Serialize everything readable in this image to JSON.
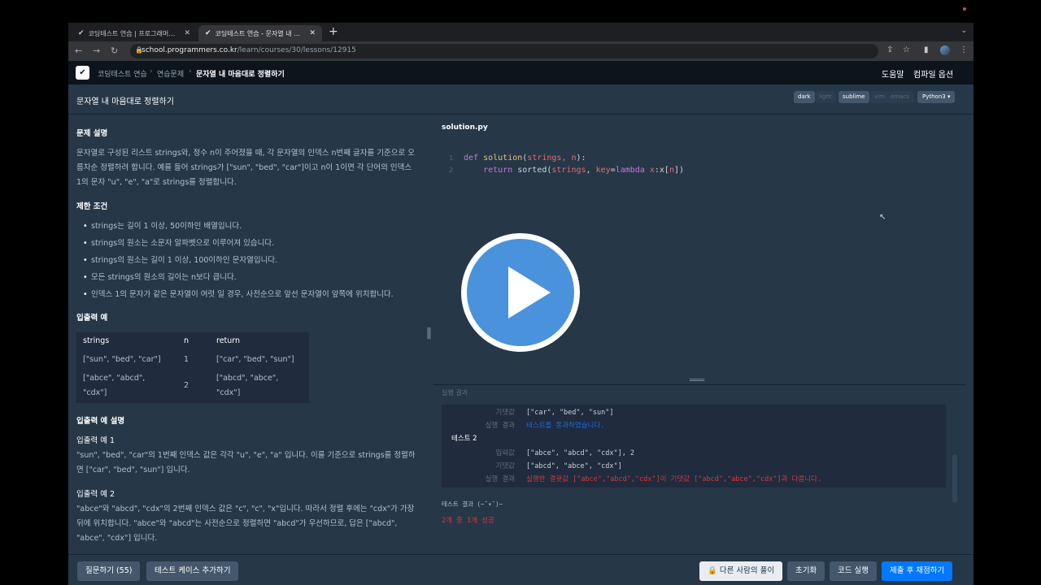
{
  "browser": {
    "tabs": [
      {
        "title": "코딩테스트 연습 | 프로그래머스 스쿨",
        "active": false
      },
      {
        "title": "코딩테스트 연습 - 문자열 내 마음대로 정렬하기",
        "active": true
      }
    ],
    "url_host": "school.programmers.co.kr",
    "url_path": "/learn/courses/30/lessons/12915"
  },
  "header": {
    "breadcrumb": [
      "코딩테스트 연습",
      "연습문제",
      "문자열 내 마음대로 정렬하기"
    ],
    "help": "도움말",
    "compile_options": "컴파일 옵션"
  },
  "titlebar": {
    "title": "문자열 내 마음대로 정렬하기",
    "themes": [
      "dark",
      "light"
    ],
    "keymaps": [
      "sublime",
      "vim",
      "emacs"
    ],
    "language": "Python3 ▾"
  },
  "problem": {
    "desc_title": "문제 설명",
    "desc": "문자열로 구성된 리스트 strings와, 정수 n이 주어졌을 때, 각 문자열의 인덱스 n번째 글자를 기준으로 오름차순 정렬하려 합니다. 예를 들어 strings가 [\"sun\", \"bed\", \"car\"]이고 n이 1이면 각 단어의 인덱스 1의 문자 \"u\", \"e\", \"a\"로 strings를 정렬합니다.",
    "constraints_title": "제한 조건",
    "constraints": [
      "strings는 길이 1 이상, 50이하인 배열입니다.",
      "strings의 원소는 소문자 알파벳으로 이루어져 있습니다.",
      "strings의 원소는 길이 1 이상, 100이하인 문자열입니다.",
      "모든 strings의 원소의 길이는 n보다 큽니다.",
      "인덱스 1의 문자가 같은 문자열이 여럿 일 경우, 사전순으로 앞선 문자열이 앞쪽에 위치합니다."
    ],
    "io_title": "입출력 예",
    "io_headers": [
      "strings",
      "n",
      "return"
    ],
    "io_rows": [
      [
        "[\"sun\", \"bed\", \"car\"]",
        "1",
        "[\"car\", \"bed\", \"sun\"]"
      ],
      [
        "[\"abce\", \"abcd\", \"cdx\"]",
        "2",
        "[\"abcd\", \"abce\", \"cdx\"]"
      ]
    ],
    "io_explain_title": "입출력 예 설명",
    "ex1_title": "입출력 예 1",
    "ex1": "\"sun\", \"bed\", \"car\"의 1번째 인덱스 값은 각각 \"u\", \"e\", \"a\" 입니다. 이를 기준으로 strings를 정렬하면 [\"car\", \"bed\", \"sun\"] 입니다.",
    "ex2_title": "입출력 예 2",
    "ex2": "\"abce\"와 \"abcd\", \"cdx\"의 2번째 인덱스 값은 \"c\", \"c\", \"x\"입니다. 따라서 정렬 후에는 \"cdx\"가 가장 뒤에 위치합니다. \"abce\"와 \"abcd\"는 사전순으로 정렬하면 \"abcd\"가 우선하므로, 답은 [\"abcd\", \"abce\", \"cdx\"] 입니다."
  },
  "editor": {
    "filename": "solution.py",
    "line_numbers": [
      "1",
      "2"
    ],
    "line1_kw": "def",
    "line1_fn": "solution",
    "line1_open": "(",
    "line1_params": "strings, n",
    "line1_close": "):",
    "line2_kw": "return",
    "line2_a": " sorted(",
    "line2_b": "strings",
    "line2_c": ", ",
    "line2_d": "key",
    "line2_e": "=",
    "line2_f": "lambda",
    "line2_g": " ",
    "line2_h": "x",
    "line2_i": ":x[",
    "line2_j": "n",
    "line2_k": "])"
  },
  "results": {
    "label": "실행 결과",
    "row1_key": "기댓값",
    "row1_val": "[\"car\", \"bed\", \"sun\"]",
    "row2_key": "실행 결과",
    "row2_val": "테스트를 통과하였습니다.",
    "test2": "테스트 2",
    "row3_key": "입력값",
    "row3_val": "[\"abce\", \"abcd\", \"cdx\"], 2",
    "row4_key": "기댓값",
    "row4_val": "[\"abcd\", \"abce\", \"cdx\"]",
    "row5_key": "실행 결과",
    "row5_val": "실행한 결괏값 [\"abce\",\"abcd\",\"cdx\"]이 기댓값 [\"abcd\",\"abce\",\"cdx\"]과 다릅니다.",
    "summary": "테스트 결과 (~˘▾˘)~",
    "score": "2개 중 1개 성공"
  },
  "footer": {
    "questions": "질문하기 (55)",
    "add_testcase": "테스트 케이스 추가하기",
    "others": "다른 사람의 풀이",
    "reset": "초기화",
    "run": "코드 실행",
    "submit": "제출 후 채점하기"
  }
}
